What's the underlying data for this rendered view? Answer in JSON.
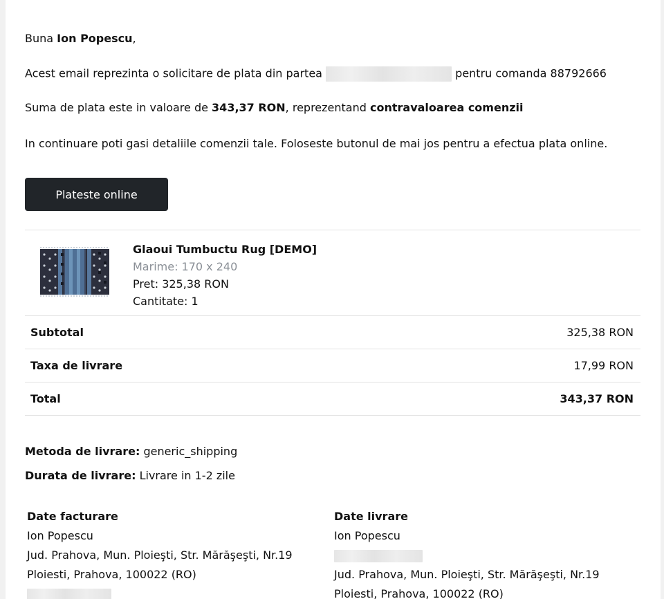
{
  "greeting": {
    "prefix": "Buna",
    "name": "Ion Popescu",
    "suffix": ","
  },
  "intro": {
    "text_before": "Acest email reprezinta o solicitare de plata din partea",
    "text_after": "pentru comanda 88792666"
  },
  "amount": {
    "prefix": "Suma de plata este in valoare de",
    "value": "343,37 RON",
    "middle": ", reprezentand",
    "reason": "contravaloarea comenzii"
  },
  "instructions": "In continuare poti gasi detaliile comenzii tale. Foloseste butonul de mai jos pentru a efectua plata online.",
  "pay_button": "Plateste online",
  "product": {
    "name": "Glaoui Tumbuctu Rug [DEMO]",
    "size": "Marime: 170 x 240",
    "price": "Pret: 325,38 RON",
    "quantity": "Cantitate: 1",
    "image_icon": "rug-image"
  },
  "totals": [
    {
      "label": "Subtotal",
      "value": "325,38 RON"
    },
    {
      "label": "Taxa de livrare",
      "value": "17,99 RON"
    },
    {
      "label": "Total",
      "value": "343,37 RON"
    }
  ],
  "shipping": {
    "method_label": "Metoda de livrare:",
    "method_value": "generic_shipping",
    "duration_label": "Durata de livrare:",
    "duration_value": "Livrare in 1-2 zile"
  },
  "billing": {
    "title": "Date facturare",
    "name": "Ion Popescu",
    "address": "Jud. Prahova, Mun. Ploieşti, Str. Mărăşeşti, Nr.19",
    "city": "Ploiesti, Prahova, 100022 (RO)"
  },
  "delivery": {
    "title": "Date livrare",
    "name": "Ion Popescu",
    "address": "Jud. Prahova, Mun. Ploieşti, Str. Mărăşeşti, Nr.19",
    "city": "Ploiesti, Prahova, 100022 (RO)"
  },
  "colors": {
    "button_bg": "#212529",
    "muted_text": "#8a8f96",
    "divider": "#e2e2e2"
  }
}
